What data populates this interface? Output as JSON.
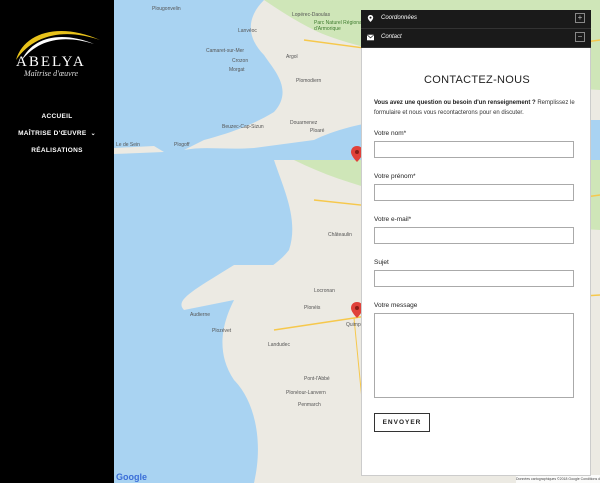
{
  "brand": {
    "name": "ABELYA",
    "tagline": "Maîtrise d'œuvre",
    "swoosh_color": "#e8c21a"
  },
  "nav": {
    "items": [
      {
        "label": "ACCUEIL"
      },
      {
        "label": "MAÎTRISE D'ŒUVRE",
        "has_submenu": true
      },
      {
        "label": "RÉALISATIONS"
      }
    ]
  },
  "map": {
    "labels": [
      {
        "text": "Plougonvelin"
      },
      {
        "text": "Lopérec-Daoulas"
      },
      {
        "text": "Parc Naturel Régional d'Armorique"
      },
      {
        "text": "Lanvéoc"
      },
      {
        "text": "Camaret-sur-Mer"
      },
      {
        "text": "Crozon"
      },
      {
        "text": "Morgat"
      },
      {
        "text": "Argol"
      },
      {
        "text": "Plomodiern"
      },
      {
        "text": "Douarnenez"
      },
      {
        "text": "Ploaré"
      },
      {
        "text": "Beuzec-Cap-Sizun"
      },
      {
        "text": "Plogoff"
      },
      {
        "text": "Le de Sein"
      },
      {
        "text": "Plonéour-Lanvern"
      },
      {
        "text": "Pont-l'Abbé"
      },
      {
        "text": "Penmarch"
      },
      {
        "text": "Plonéis"
      },
      {
        "text": "Quimper"
      },
      {
        "text": "Châteaulin"
      },
      {
        "text": "Landudec"
      },
      {
        "text": "Locronan"
      },
      {
        "text": "Plozévet"
      },
      {
        "text": "Audierne"
      }
    ],
    "google_label": "Google",
    "attribution": "Données cartographiques ©2018 Google   Conditions d'utilisation   Signaler une erreur cartographique",
    "marker_color": "#e0413a"
  },
  "panel": {
    "tabs": [
      {
        "title": "Coordonnées",
        "icon": "map-pin-icon",
        "toggle": "+"
      },
      {
        "title": "Contact",
        "icon": "envelope-icon",
        "toggle": "−"
      }
    ],
    "form": {
      "title": "CONTACTEZ-NOUS",
      "intro_bold": "Vous avez une question ou besoin d'un renseignement ?",
      "intro_text": " Remplissez le formulaire et nous vous recontacterons pour en discuter.",
      "fields": {
        "nom": {
          "label": "Votre nom*",
          "value": ""
        },
        "prenom": {
          "label": "Votre prénom*",
          "value": ""
        },
        "email": {
          "label": "Votre e-mail*",
          "value": ""
        },
        "sujet": {
          "label": "Sujet",
          "value": ""
        },
        "message": {
          "label": "Votre message",
          "value": ""
        }
      },
      "submit_label": "ENVOYER"
    }
  }
}
